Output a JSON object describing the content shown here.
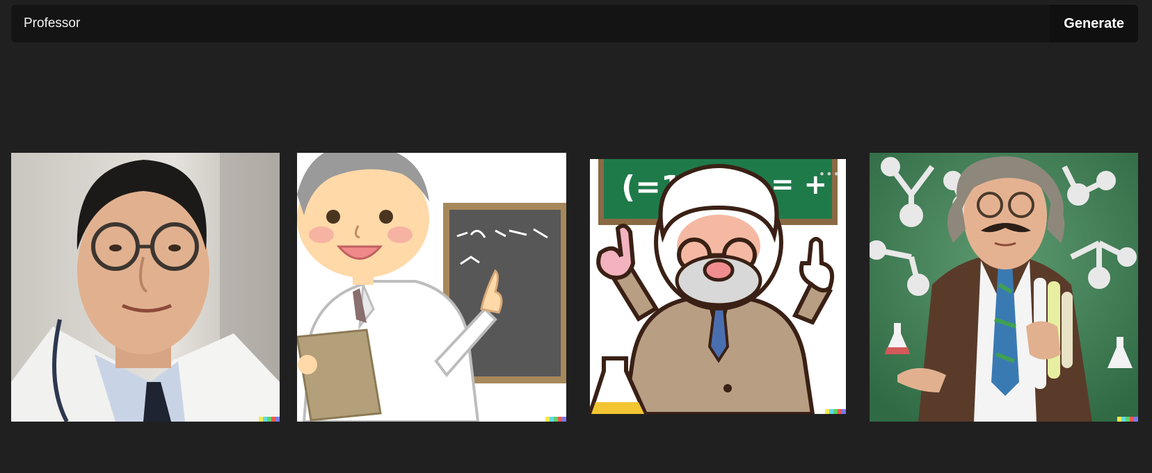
{
  "prompt": {
    "value": "Professor",
    "placeholder": ""
  },
  "generate": {
    "label": "Generate"
  },
  "images": [
    {
      "subject": "photo of smiling professor with glasses and stethoscope in white lab coat"
    },
    {
      "subject": "cartoon professor in lab coat holding a book and pointing at a chalkboard"
    },
    {
      "subject": "cartoon old professor with white hair and glasses pointing up in front of a green chalkboard with equations"
    },
    {
      "subject": "photo of eccentric professor with mustache holding test tubes in front of a molecule wall"
    }
  ],
  "signature_colors": [
    "#f7e84a",
    "#62d9e8",
    "#5ad36d",
    "#ef5a4a",
    "#7a7af0"
  ]
}
